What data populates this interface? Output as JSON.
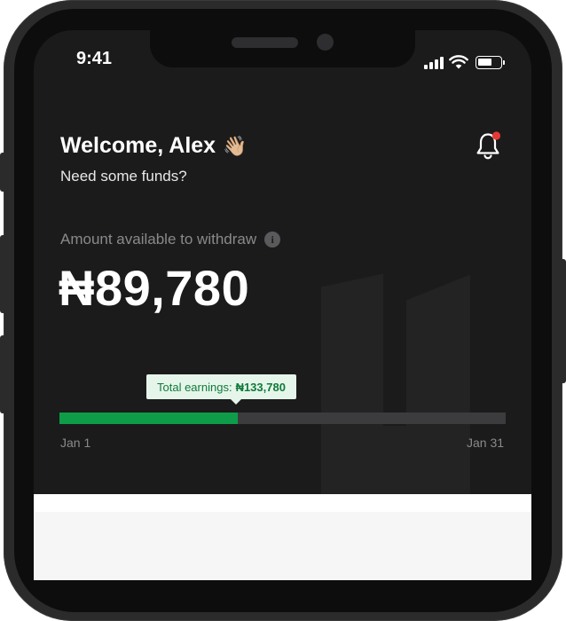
{
  "status_bar": {
    "time": "9:41"
  },
  "header": {
    "welcome": "Welcome, Alex",
    "wave_emoji": "👋🏼",
    "subtitle": "Need some funds?"
  },
  "balance": {
    "label": "Amount available to withdraw",
    "amount": "₦89,780"
  },
  "earnings": {
    "label": "Total earnings:",
    "value": "₦133,780",
    "progress_fraction": 0.4,
    "start_label": "Jan 1",
    "end_label": "Jan 31"
  },
  "icons": {
    "bell": "bell-icon",
    "info": "info-icon",
    "signal": "signal-icon",
    "wifi": "wifi-icon",
    "battery": "battery-icon"
  },
  "colors": {
    "accent": "#0e9c49",
    "background": "#1b1b1c",
    "notification_dot": "#e53935",
    "tooltip_bg": "#e6f5ea",
    "tooltip_text": "#0f7a3a"
  }
}
